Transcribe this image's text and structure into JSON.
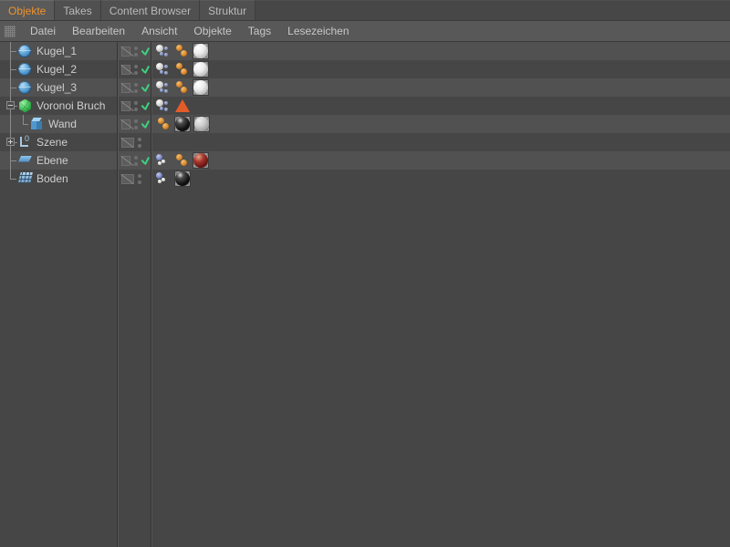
{
  "tabs": [
    {
      "label": "Objekte",
      "active": true
    },
    {
      "label": "Takes",
      "active": false
    },
    {
      "label": "Content Browser",
      "active": false
    },
    {
      "label": "Struktur",
      "active": false
    }
  ],
  "menu": {
    "grip_icon": "grip-handle-icon",
    "items": [
      "Datei",
      "Bearbeiten",
      "Ansicht",
      "Objekte",
      "Tags",
      "Lesezeichen"
    ]
  },
  "colors": {
    "accent": "#f0922b",
    "row_light": "#515151",
    "row_dark": "#464646",
    "text": "#cfcfcf",
    "check": "#3fd07f",
    "divider": "#343434",
    "triangle_tag": "#e25c28"
  },
  "tree": {
    "rows": [
      {
        "name": "Kugel_1",
        "icon": "sphere-object-icon",
        "depth": 1,
        "expander": "none",
        "layer": true,
        "dots": 2,
        "enabled": true,
        "tags": [
          "phong-tag",
          "dynamics-body-tag",
          "material-white-tag"
        ]
      },
      {
        "name": "Kugel_2",
        "icon": "sphere-object-icon",
        "depth": 1,
        "expander": "none",
        "layer": true,
        "dots": 2,
        "enabled": true,
        "tags": [
          "phong-tag",
          "dynamics-body-tag",
          "material-white-tag"
        ]
      },
      {
        "name": "Kugel_3",
        "icon": "sphere-object-icon",
        "depth": 1,
        "expander": "none",
        "layer": true,
        "dots": 2,
        "enabled": true,
        "tags": [
          "phong-tag",
          "dynamics-body-tag",
          "material-white-tag"
        ]
      },
      {
        "name": "Voronoi Bruch",
        "icon": "voronoi-fracture-icon",
        "depth": 1,
        "expander": "collapse",
        "layer": true,
        "dots": 2,
        "enabled": true,
        "tags": [
          "phong-tag",
          "triangle-tag"
        ]
      },
      {
        "name": "Wand",
        "icon": "cube-object-icon",
        "depth": 2,
        "expander": "none",
        "layer": true,
        "dots": 2,
        "enabled": true,
        "tags": [
          "dynamics-body-tag",
          "material-black-tag",
          "material-grey-tag"
        ]
      },
      {
        "name": "Szene",
        "icon": "null-object-icon",
        "depth": 1,
        "expander": "expand",
        "layer": true,
        "dots": 2,
        "enabled": false,
        "tags": []
      },
      {
        "name": "Ebene",
        "icon": "plane-object-icon",
        "depth": 1,
        "expander": "none",
        "layer": true,
        "dots": 2,
        "enabled": true,
        "tags": [
          "collider-body-tag",
          "dynamics-body-tag",
          "material-red-tag"
        ]
      },
      {
        "name": "Boden",
        "icon": "floor-object-icon",
        "depth": 1,
        "expander": "none",
        "layer": true,
        "dots": 2,
        "enabled": false,
        "tags": [
          "collider-body-tag",
          "material-black-tag"
        ]
      }
    ]
  }
}
